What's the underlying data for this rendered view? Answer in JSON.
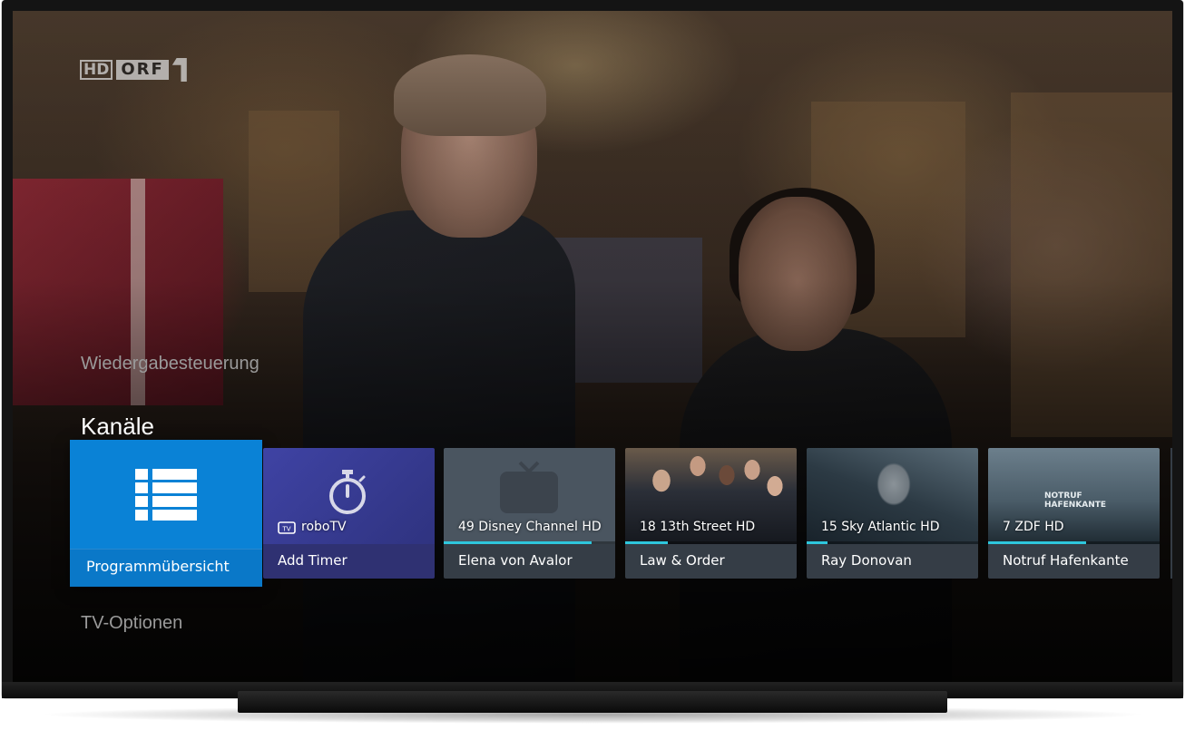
{
  "overlay": {
    "channel_logo": {
      "hd": "HD",
      "orf": "ORF",
      "one_icon": "orf-1-glyph"
    },
    "menu_top_label": "Wiedergabesteuerung",
    "section_title": "Kanäle",
    "menu_bottom_label": "TV-Optionen"
  },
  "tiles": [
    {
      "label": "Programmübersicht",
      "icon": "list-icon",
      "focused": true
    },
    {
      "channel": "roboTV",
      "channel_icon": "tv-icon",
      "title": "Add Timer",
      "icon": "stopwatch-icon"
    },
    {
      "channel": "49 Disney Channel HD",
      "title": "Elena von Avalor",
      "progress": 0.86,
      "icon": "tv-placeholder-icon"
    },
    {
      "channel": "18 13th Street HD",
      "title": "Law & Order",
      "progress": 0.25
    },
    {
      "channel": "15 Sky Atlantic HD",
      "title": "Ray Donovan",
      "progress": 0.12
    },
    {
      "channel": "7 ZDF HD",
      "title": "Notruf Hafenkante",
      "progress": 0.57,
      "thumb_text": "NOTRUF HAFENKANTE"
    }
  ],
  "colors": {
    "focus_blue": "#0a82d6",
    "progress_cyan": "#2ec6dc",
    "tile_bar": "#3a424c",
    "robotv_purple": "#3b3f9a"
  }
}
